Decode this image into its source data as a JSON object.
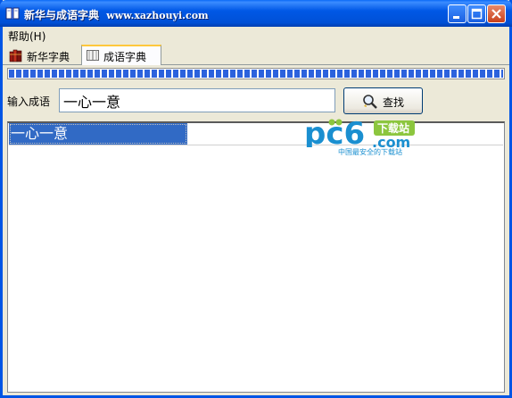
{
  "window": {
    "title": "新华与成语字典",
    "title_url": "www.xazhouyi.com"
  },
  "menu": {
    "help_label": "帮助(H)"
  },
  "tabs": [
    {
      "label": "新华字典"
    },
    {
      "label": "成语字典"
    }
  ],
  "progress": {
    "fraction": 1.0
  },
  "search": {
    "label": "输入成语",
    "value": "一心一意",
    "button_label": "查找"
  },
  "results": {
    "rows": [
      {
        "text": "一心一意",
        "selected": true
      }
    ]
  },
  "watermark": {
    "brand": "pc6",
    "badge": "下载站",
    "domain": ".com",
    "tagline": "中国最安全的下载站"
  },
  "colors": {
    "titlebar": "#0058e6",
    "selection": "#316ac5",
    "progress": "#2c62dd",
    "watermark": "#1a8fd0"
  }
}
